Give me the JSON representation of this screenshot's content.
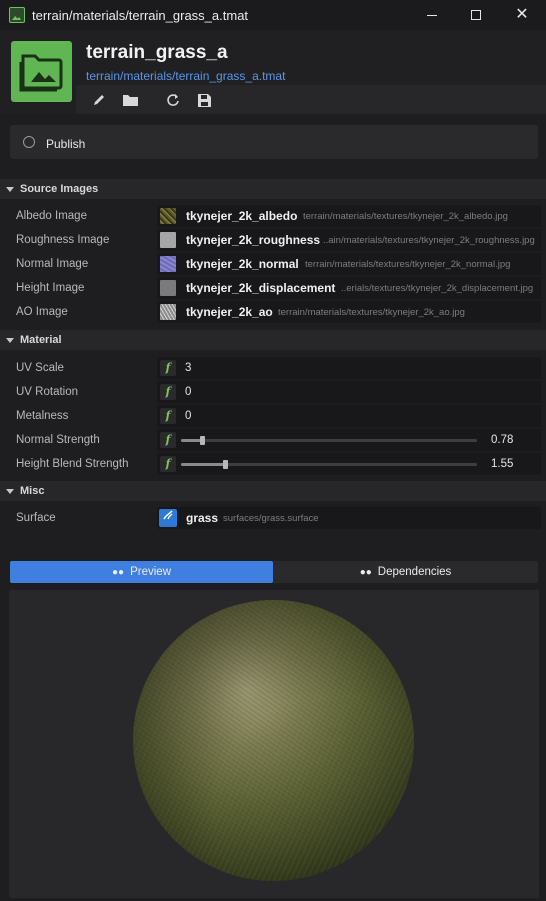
{
  "window": {
    "title": "terrain/materials/terrain_grass_a.tmat",
    "minimize_glyph": "—",
    "maximize_glyph": "☐",
    "close_glyph": "✕"
  },
  "header": {
    "asset_name": "terrain_grass_a",
    "asset_path": "terrain/materials/terrain_grass_a.tmat",
    "icon": "image-folder-icon",
    "accent_color": "#5fb653",
    "toolbar": [
      "pencil-icon",
      "folder-icon",
      "reload-icon",
      "save-icon"
    ]
  },
  "publish": {
    "label": "Publish",
    "checked": false
  },
  "sections": {
    "source_images": {
      "title": "Source Images",
      "rows": [
        {
          "label": "Albedo Image",
          "name": "tkynejer_2k_albedo",
          "path": "terrain/materials/textures/tkynejer_2k_albedo.jpg"
        },
        {
          "label": "Roughness Image",
          "name": "tkynejer_2k_roughness",
          "path": "..ain/materials/textures/tkynejer_2k_roughness.jpg"
        },
        {
          "label": "Normal Image",
          "name": "tkynejer_2k_normal",
          "path": "terrain/materials/textures/tkynejer_2k_normal.jpg"
        },
        {
          "label": "Height Image",
          "name": "tkynejer_2k_displacement",
          "path": "..erials/textures/tkynejer_2k_displacement.jpg"
        },
        {
          "label": "AO Image",
          "name": "tkynejer_2k_ao",
          "path": "terrain/materials/textures/tkynejer_2k_ao.jpg"
        }
      ]
    },
    "material": {
      "title": "Material",
      "type_badge": "f",
      "rows": [
        {
          "label": "UV Scale",
          "value": "3"
        },
        {
          "label": "UV Rotation",
          "value": "0"
        },
        {
          "label": "Metalness",
          "value": "0"
        },
        {
          "label": "Normal Strength",
          "value": "0.78",
          "slider_fraction": 0.07
        },
        {
          "label": "Height Blend Strength",
          "value": "1.55",
          "slider_fraction": 0.15
        }
      ]
    },
    "misc": {
      "title": "Misc",
      "rows": [
        {
          "label": "Surface",
          "name": "grass",
          "path": "surfaces/grass.surface"
        }
      ]
    }
  },
  "tabs": {
    "preview": "Preview",
    "dependencies": "Dependencies",
    "active": "preview",
    "active_color": "#3f7fe0"
  }
}
